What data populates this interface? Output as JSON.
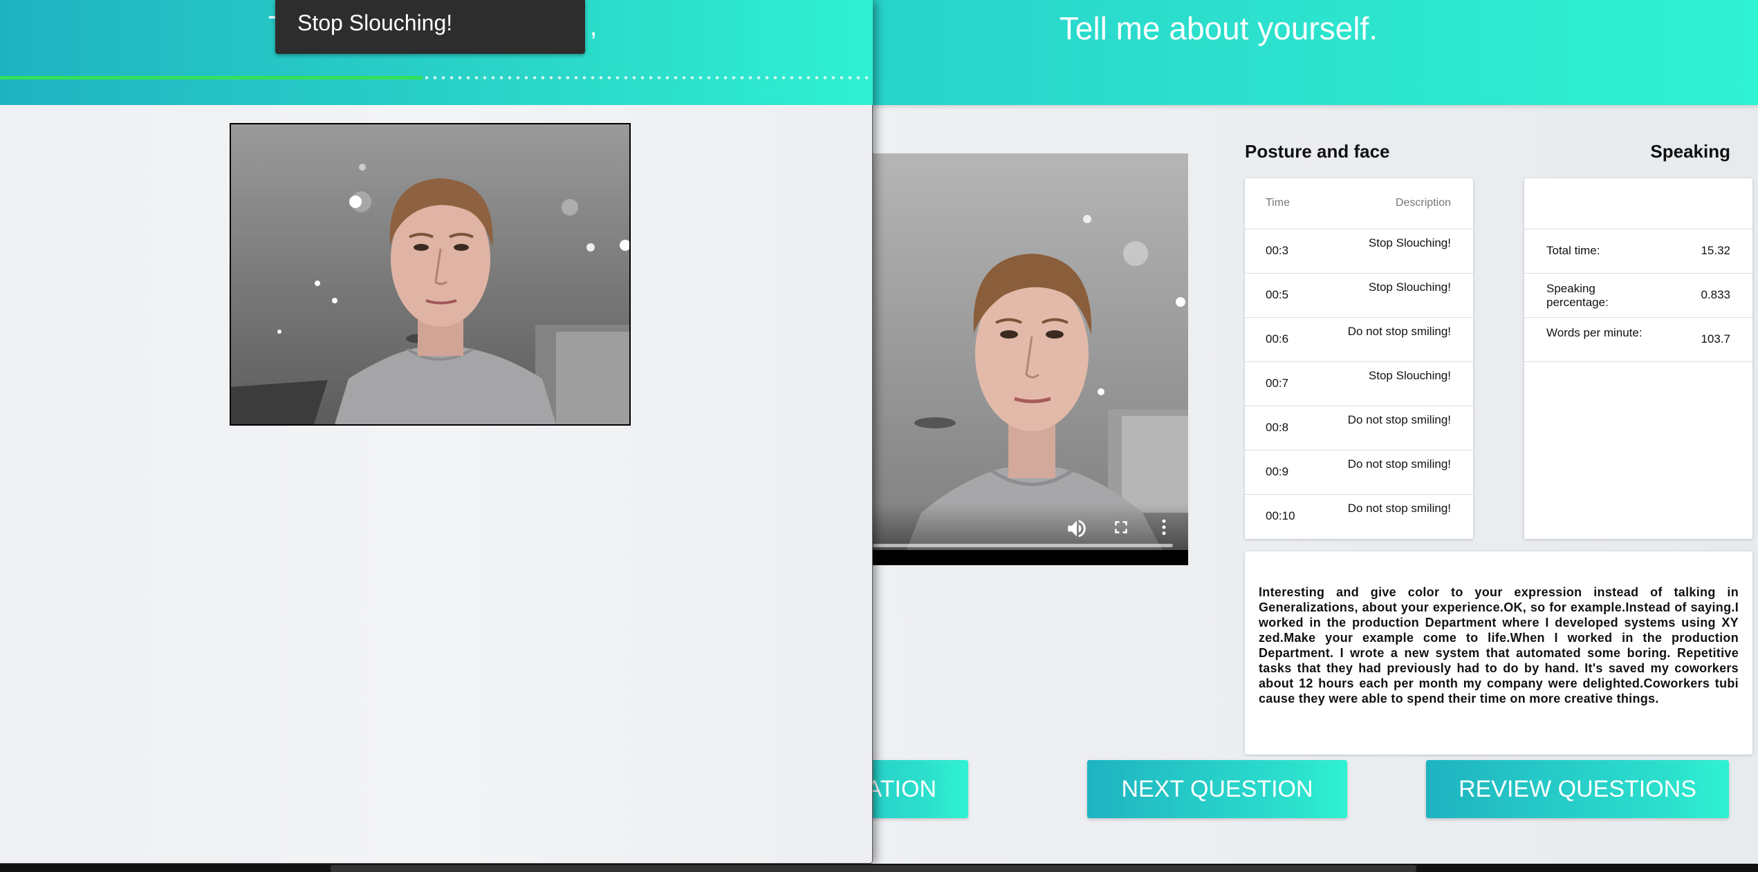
{
  "right_window": {
    "question_title": "Tell me about yourself.",
    "posture_section_title": "Posture and face",
    "speaking_section_title": "Speaking",
    "posture_table": {
      "headers": [
        "Time",
        "Description"
      ],
      "rows": [
        {
          "time": "00:3",
          "description": "Stop Slouching!"
        },
        {
          "time": "00:5",
          "description": "Stop Slouching!"
        },
        {
          "time": "00:6",
          "description": "Do not stop smiling!"
        },
        {
          "time": "00:7",
          "description": "Stop Slouching!"
        },
        {
          "time": "00:8",
          "description": "Do not stop smiling!"
        },
        {
          "time": "00:9",
          "description": "Do not stop smiling!"
        },
        {
          "time": "00:10",
          "description": "Do not stop smiling!"
        }
      ]
    },
    "speaking_stats": [
      {
        "label": "Total time:",
        "value": "15.32"
      },
      {
        "label": "Speaking percentage:",
        "value": "0.833"
      },
      {
        "label": "Words per minute:",
        "value": "103.7"
      }
    ],
    "transcript": "Interesting and give color to your expression instead of talking in Generalizations, about your experience.OK, so for example.Instead of saying.I worked in the production Department where I developed systems using XY zed.Make your example come to life.When I worked in the production Department. I wrote a new system that automated some boring. Repetitive tasks that they had previously had to do by hand. It's saved my coworkers about 12 hours each per month my company were delighted.Coworkers tubi cause they were able to spend their time on more creative things.",
    "buttons": {
      "partial_label": "ATION",
      "next_label": "NEXT QUESTION",
      "review_label": "REVIEW QUESTIONS"
    },
    "video_controls": [
      "volume-icon",
      "fullscreen-icon",
      "more-vert-icon"
    ]
  },
  "left_window": {
    "toast_text": "Stop Slouching!",
    "progress": 0.485,
    "title_fragment_left": "T",
    "title_fragment_right": ","
  },
  "colors": {
    "header_gradient_start": "#1fb3c1",
    "header_gradient_end": "#2ff2d2",
    "progress_done": "#34e05a",
    "toast_bg": "#2d2d2d"
  }
}
